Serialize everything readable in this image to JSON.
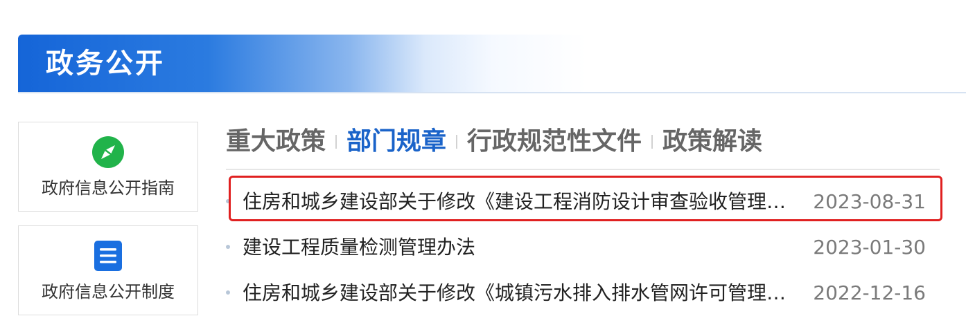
{
  "header": {
    "title": "政务公开"
  },
  "side_cards": [
    {
      "label": "政府信息公开指南",
      "icon": "compass-icon",
      "icon_color": "#21b34a"
    },
    {
      "label": "政府信息公开制度",
      "icon": "document-icon",
      "icon_color": "#1a6fe0"
    }
  ],
  "tabs": [
    {
      "label": "重大政策",
      "active": false
    },
    {
      "label": "部门规章",
      "active": true
    },
    {
      "label": "行政规范性文件",
      "active": false
    },
    {
      "label": "政策解读",
      "active": false
    }
  ],
  "list": [
    {
      "title": "住房和城乡建设部关于修改《建设工程消防设计审查验收管理暂行规定》的决定",
      "date": "2023-08-31",
      "highlighted": true
    },
    {
      "title": "建设工程质量检测管理办法",
      "date": "2023-01-30",
      "highlighted": false
    },
    {
      "title": "住房和城乡建设部关于修改《城镇污水排入排水管网许可管理办法》的决定",
      "date": "2022-12-16",
      "highlighted": false
    }
  ],
  "colors": {
    "accent": "#1a63c9",
    "highlight_border": "#e02020",
    "tab_inactive": "#666666"
  }
}
